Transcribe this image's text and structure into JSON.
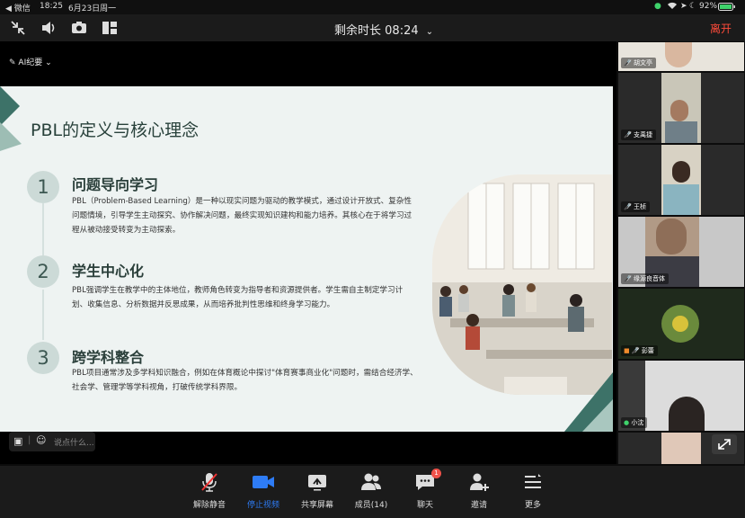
{
  "status_bar": {
    "back_label": "◀ 微信",
    "time": "18:25",
    "date": "6月23日周一",
    "battery_percent": "92%"
  },
  "top_bar": {
    "timer_label": "剩余时长",
    "timer_value": "08:24",
    "leave_label": "离开"
  },
  "ai_notes": {
    "label": "AI纪要"
  },
  "slide": {
    "title": "PBL的定义与核心理念",
    "sections": [
      {
        "number": "1",
        "title": "问题导向学习",
        "body": "PBL（Problem-Based Learning）是一种以现实问题为驱动的教学模式，通过设计开放式、复杂性问题情境，引导学生主动探究、协作解决问题，最终实现知识建构和能力培养。其核心在于将学习过程从被动接受转变为主动探索。"
      },
      {
        "number": "2",
        "title": "学生中心化",
        "body": "PBL强调学生在教学中的主体地位，教师角色转变为指导者和资源提供者。学生需自主制定学习计划、收集信息、分析数据并反思成果，从而培养批判性思维和终身学习能力。"
      },
      {
        "number": "3",
        "title": "跨学科整合",
        "body": "PBL项目通常涉及多学科知识融合，例如在体育概论中探讨\"体育赛事商业化\"问题时，需结合经济学、社会学、管理学等学科视角，打破传统学科界限。"
      }
    ]
  },
  "participants": [
    {
      "name": "胡文亭"
    },
    {
      "name": "支禹捷"
    },
    {
      "name": "王桢"
    },
    {
      "name": "缘源良音体"
    },
    {
      "name": "彭蕾"
    },
    {
      "name": "小沈"
    }
  ],
  "chat_input": {
    "placeholder": "说点什么..."
  },
  "bottom_bar": {
    "items": [
      {
        "label": "解除静音",
        "icon": "mic-muted-icon"
      },
      {
        "label": "停止视频",
        "icon": "video-icon"
      },
      {
        "label": "共享屏幕",
        "icon": "share-screen-icon"
      },
      {
        "label": "成员(14)",
        "icon": "members-icon"
      },
      {
        "label": "聊天",
        "icon": "chat-icon",
        "badge": "1"
      },
      {
        "label": "邀请",
        "icon": "invite-icon"
      },
      {
        "label": "更多",
        "icon": "more-icon"
      }
    ]
  },
  "colors": {
    "accent_blue": "#2e7cf6",
    "leave_red": "#ff4b3a",
    "slide_bg": "#eef3f2",
    "slide_teal": "#3d7268"
  }
}
